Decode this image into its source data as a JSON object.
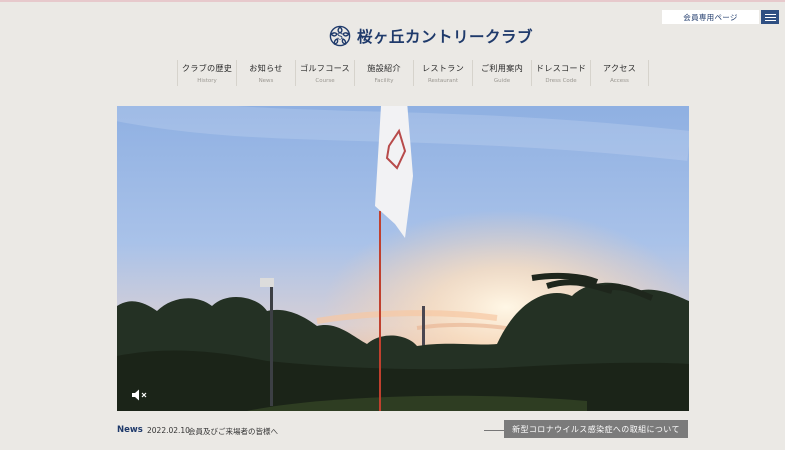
{
  "header": {
    "member_label": "会員専用ページ",
    "logo_text": "桜ヶ丘カントリークラブ"
  },
  "nav": {
    "items": [
      {
        "jp": "クラブの歴史",
        "en": "History"
      },
      {
        "jp": "お知らせ",
        "en": "News"
      },
      {
        "jp": "ゴルフコース",
        "en": "Course"
      },
      {
        "jp": "施設紹介",
        "en": "Facility"
      },
      {
        "jp": "レストラン",
        "en": "Restaurant"
      },
      {
        "jp": "ご利用案内",
        "en": "Guide"
      },
      {
        "jp": "ドレスコード",
        "en": "Dress Code"
      },
      {
        "jp": "アクセス",
        "en": "Access"
      }
    ]
  },
  "news": {
    "label": "News",
    "date": "2022.02.10",
    "title": "会員及びご来場者の皆様へ"
  },
  "covid_button": "新型コロナウイルス感染症への取組について",
  "icons": {
    "menu": "hamburger-icon",
    "logo": "sakura-emblem-icon",
    "mute": "speaker-muted-icon"
  },
  "colors": {
    "brand": "#1f3a6b",
    "menu_button": "#2f4f82",
    "background": "#ebe9e5",
    "covid_button": "#7b7b7b"
  }
}
